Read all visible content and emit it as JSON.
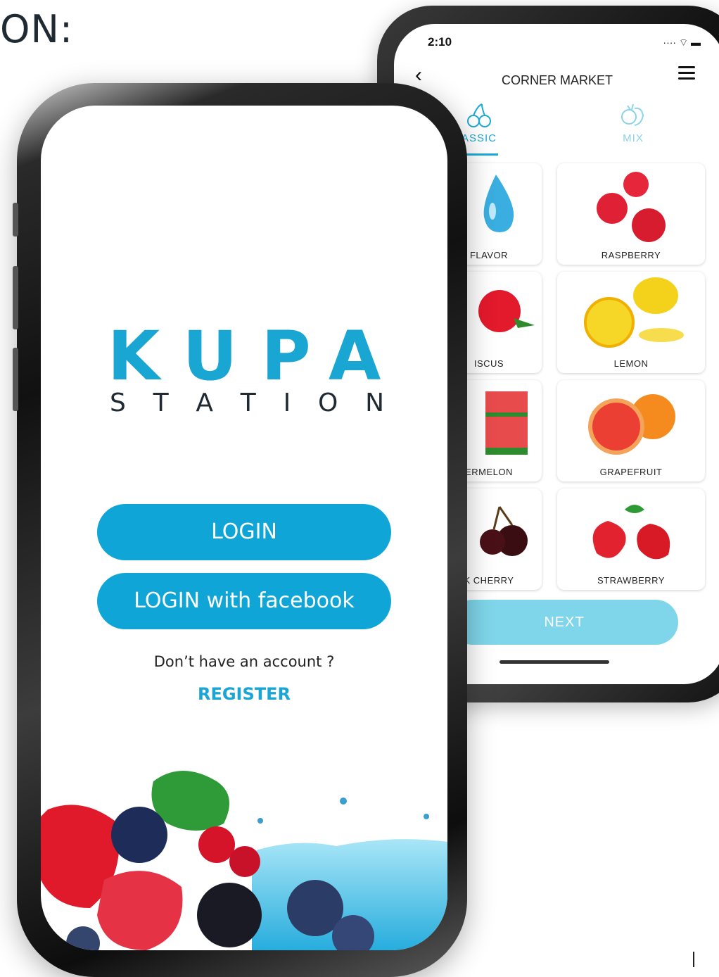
{
  "page_heading_fragment": "ON:",
  "back_phone": {
    "status_time": "2:10",
    "status_icons": "···· ⌔ ▬",
    "back_icon": "chevron-left-icon",
    "title": "CORNER MARKET",
    "tabs": [
      {
        "label": "ASSIC",
        "icon": "cherry-icon",
        "active": true
      },
      {
        "label": "MIX",
        "icon": "fruit-basket-icon",
        "active": false
      }
    ],
    "cards": [
      {
        "label": "FLAVOR",
        "icon": "water-drop-icon"
      },
      {
        "label": "RASPBERRY",
        "icon": "raspberry-icon"
      },
      {
        "label": "ISCUS",
        "icon": "hibiscus-icon"
      },
      {
        "label": "LEMON",
        "icon": "lemon-icon"
      },
      {
        "label": "ERMELON",
        "icon": "watermelon-icon"
      },
      {
        "label": "GRAPEFRUIT",
        "icon": "grapefruit-icon"
      },
      {
        "label": "K CHERRY",
        "icon": "cherry-icon"
      },
      {
        "label": "STRAWBERRY",
        "icon": "strawberry-icon"
      }
    ],
    "next_label": "NEXT"
  },
  "front_phone": {
    "logo_primary": "KUPA",
    "logo_secondary_letters": [
      "S",
      "T",
      "A",
      "T",
      "I",
      "O",
      "N"
    ],
    "login_label": "LOGIN",
    "login_facebook_label": "LOGIN with facebook",
    "no_account_text": "Don’t have an account ?",
    "register_label": "REGISTER"
  },
  "colors": {
    "brand_blue": "#0fa5d6",
    "next_button": "#7fd6ea",
    "tab_active": "#1da9d4",
    "tab_inactive": "#8bd3ea"
  }
}
